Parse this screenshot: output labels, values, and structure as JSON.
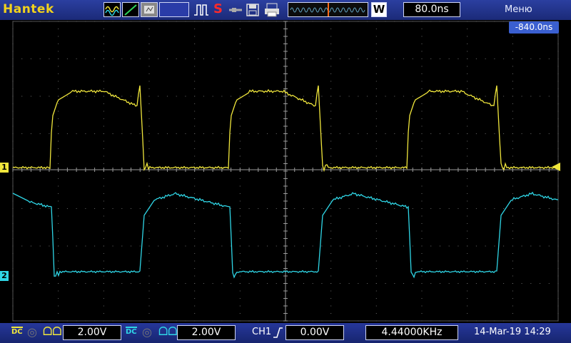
{
  "header": {
    "brand": "Hantek",
    "timebase": "80.0ns",
    "menu_label": "Меню",
    "h_position": "-840.0ns",
    "run_indicator": "S",
    "window_label": "W"
  },
  "channels": [
    {
      "id": "1",
      "color": "#f0e63c",
      "volts": "2.00V",
      "coupling": "DC"
    },
    {
      "id": "2",
      "color": "#2fd6e6",
      "volts": "2.00V",
      "coupling": "DC"
    }
  ],
  "trigger": {
    "source": "CH1",
    "level": "0.00V"
  },
  "frequency": "4.44000KHz",
  "datetime": "14-Mar-19 14:29",
  "icons": [
    "ch1-waveform-icon",
    "ch2-ramp-icon",
    "math-icon",
    "rise-fall-icon",
    "cursor-icon",
    "save-icon",
    "print-icon",
    "window-zoom-icon"
  ],
  "colors": {
    "ch1": "#f0e63c",
    "ch2": "#2fd6e6",
    "bar": "#1f2f86",
    "grid": "#5a5a5a"
  }
}
